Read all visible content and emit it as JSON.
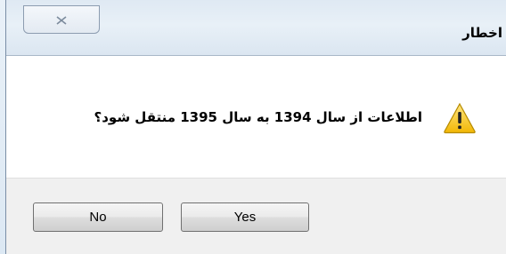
{
  "window": {
    "title": "اخطار",
    "close_icon": "close-icon"
  },
  "dialog": {
    "message": "اطلاعات از سال 1394 به سال 1395 منتقل شود؟",
    "icon": "warning-icon"
  },
  "buttons": {
    "no_label": "No",
    "yes_label": "Yes"
  },
  "colors": {
    "warning_yellow": "#f5c518",
    "footer_bg": "#f0f0f0"
  }
}
